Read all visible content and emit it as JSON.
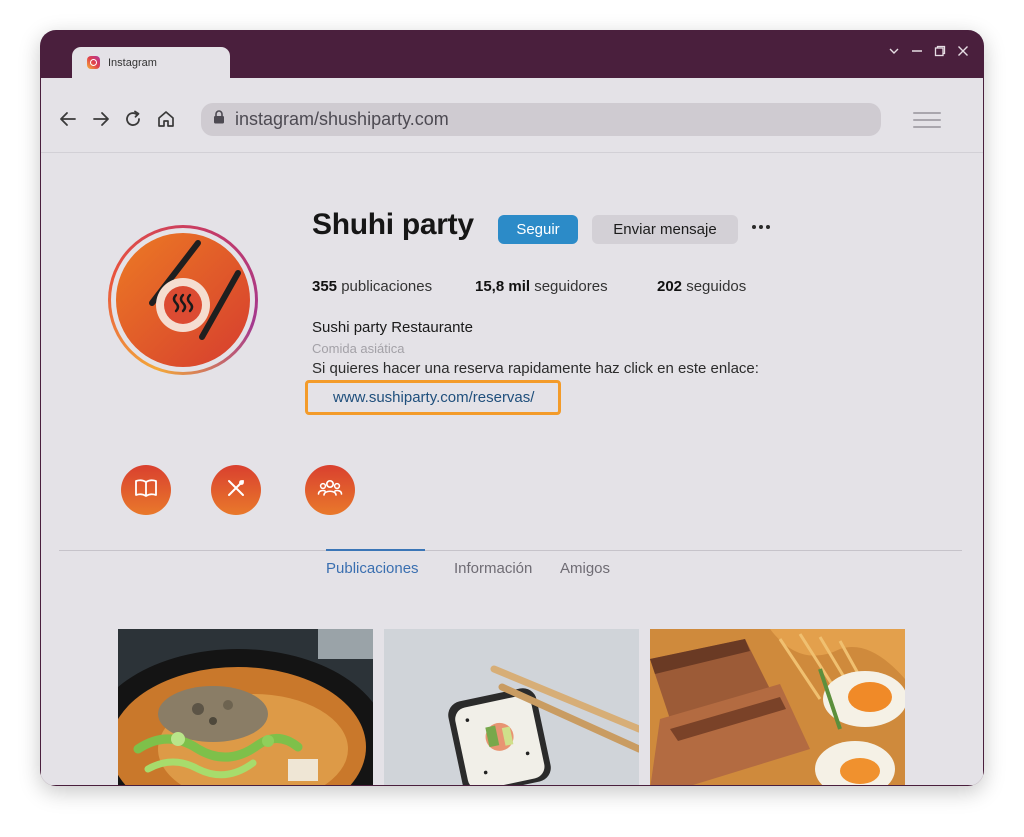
{
  "browser": {
    "tab_title": "Instagram",
    "url": "instagram/shushiparty.com",
    "icons": {
      "tab": "instagram-icon",
      "back": "arrow-left-icon",
      "forward": "arrow-right-icon",
      "reload": "reload-icon",
      "home": "home-icon",
      "lock": "lock-icon",
      "menu": "hamburger-menu-icon"
    }
  },
  "profile": {
    "username": "Shuhi party",
    "follow_label": "Seguir",
    "message_label": "Enviar mensaje",
    "stats": {
      "posts_count": "355",
      "posts_label": "publicaciones",
      "followers_count": "15,8 mil",
      "followers_label": "seguidores",
      "following_count": "202",
      "following_label": "seguidos"
    },
    "bio": {
      "name": "Sushi party Restaurante",
      "category": "Comida asiática",
      "text": "Si quieres hacer una reserva rapidamente haz click en este enlace:",
      "link": "www.sushiparty.com/reservas/"
    },
    "highlights": [
      {
        "icon": "book-icon"
      },
      {
        "icon": "utensils-icon"
      },
      {
        "icon": "group-icon"
      }
    ]
  },
  "tabs": [
    {
      "label": "Publicaciones",
      "active": true
    },
    {
      "label": "Información",
      "active": false
    },
    {
      "label": "Amigos",
      "active": false
    }
  ],
  "posts": [
    {
      "subject": "ramen bowl photo"
    },
    {
      "subject": "sushi roll with chopsticks photo"
    },
    {
      "subject": "pork belly and egg photo"
    }
  ],
  "colors": {
    "window_frame": "#4a1f3d",
    "follow_button": "#2c8bc8",
    "link_highlight": "#f39b2a",
    "active_tab": "#3a6fb0",
    "brand_orange": "#e9792b"
  }
}
